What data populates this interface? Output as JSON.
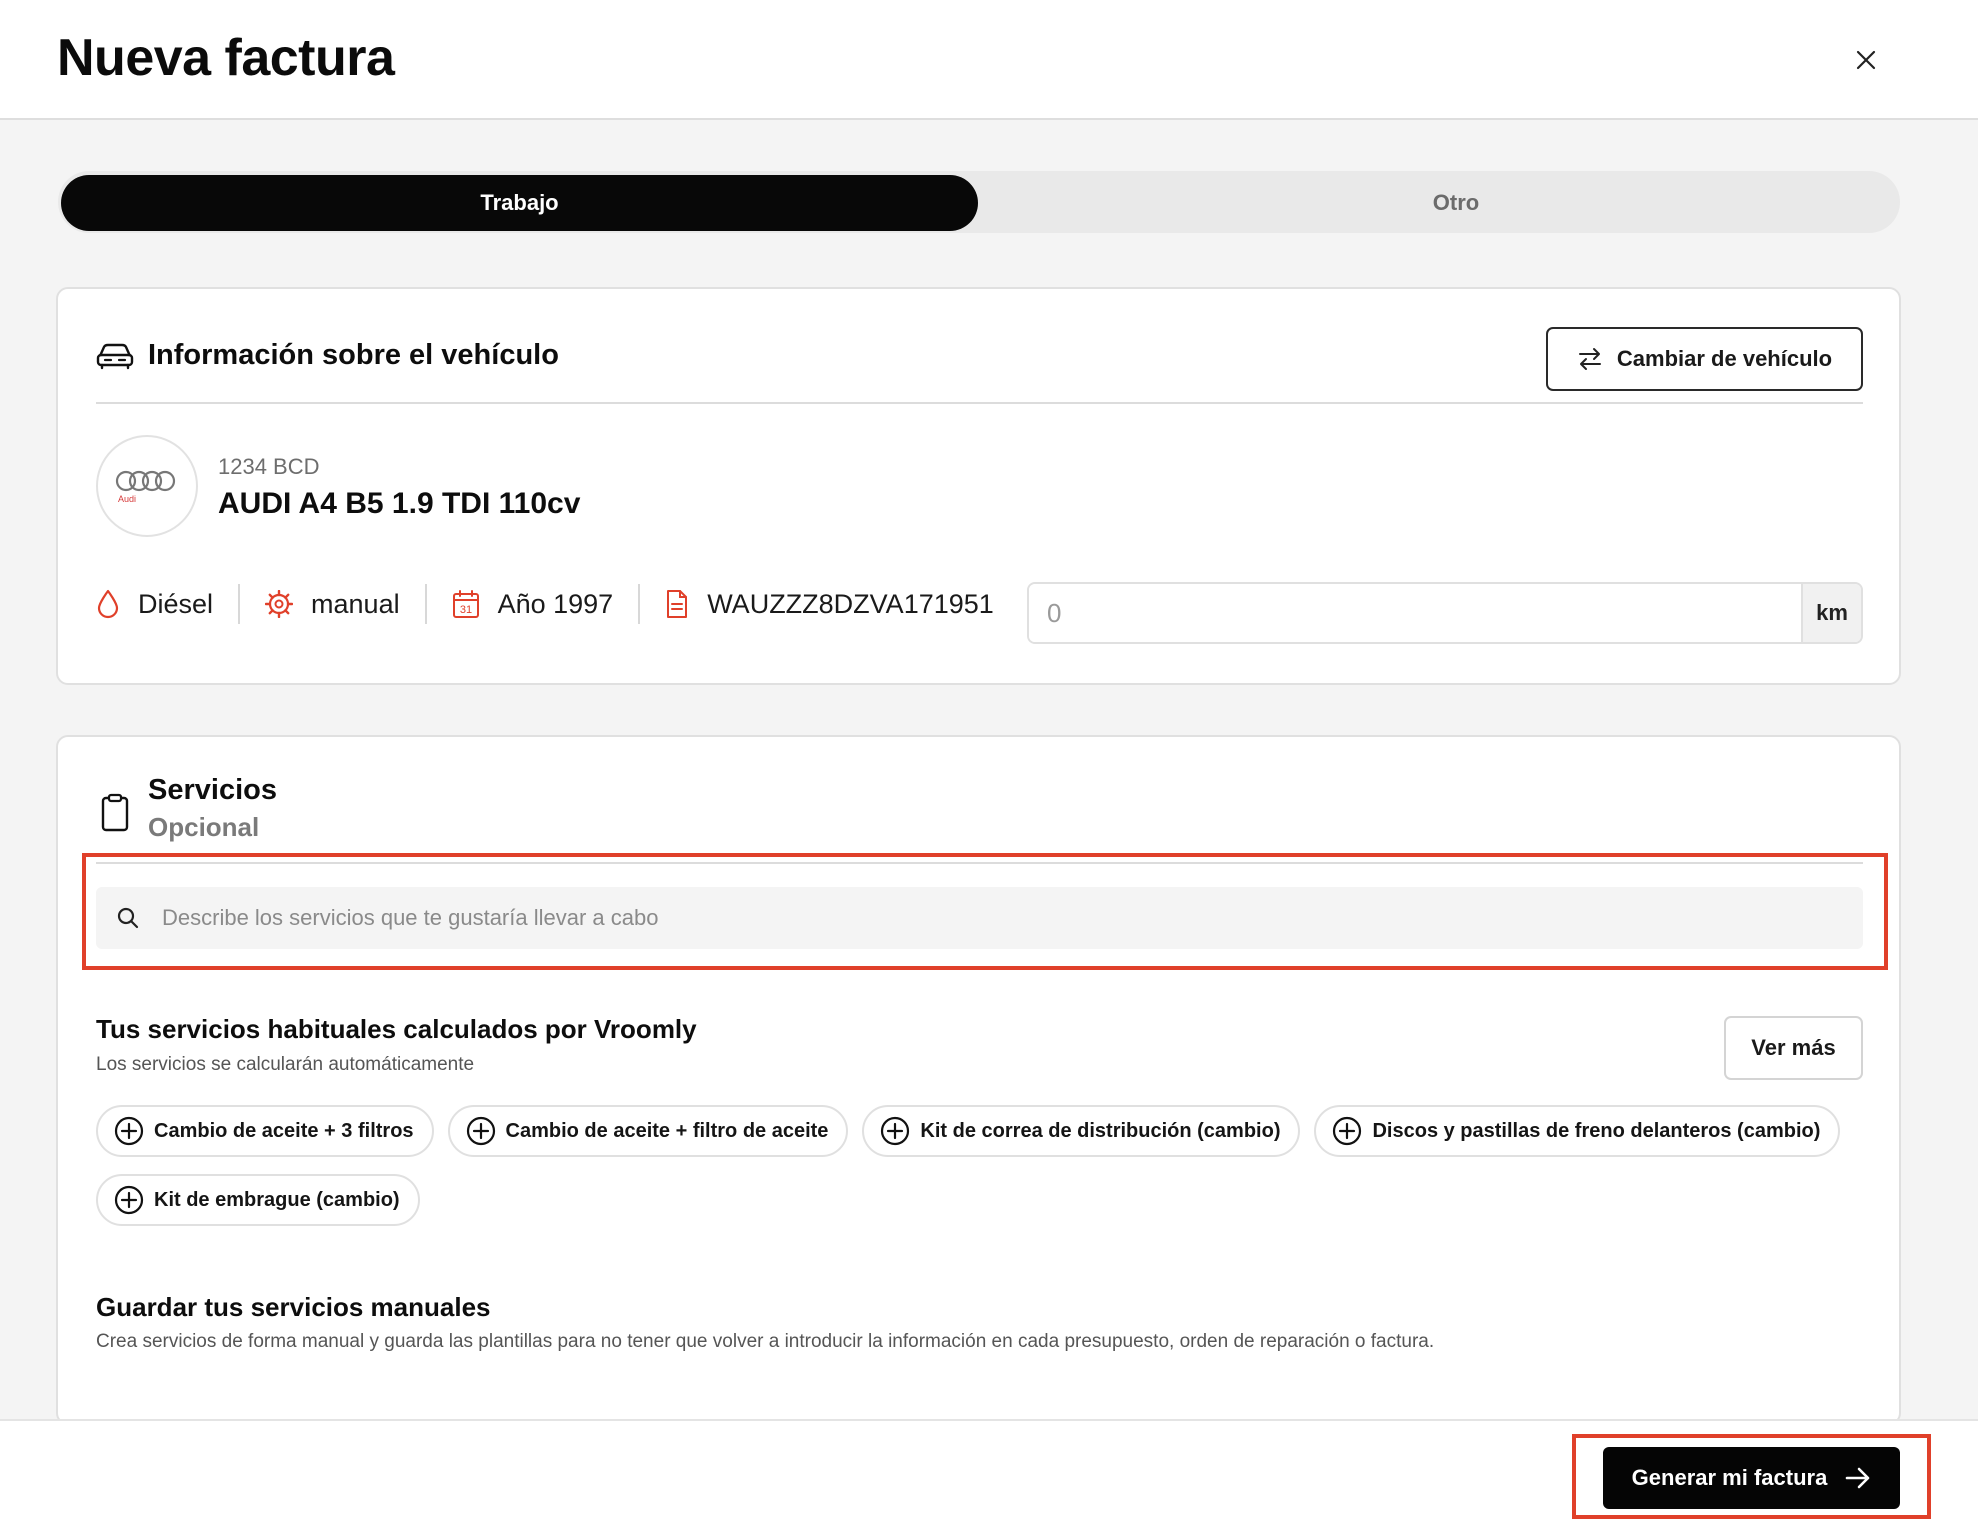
{
  "header": {
    "title": "Nueva factura"
  },
  "tabs": {
    "active": "Trabajo",
    "inactive": "Otro"
  },
  "vehicle": {
    "section_title": "Información sobre el vehículo",
    "change_button": "Cambiar de vehículo",
    "brand_logo_text": "Audi",
    "plate": "1234 BCD",
    "model": "AUDI A4 B5 1.9 TDI 110cv",
    "fuel": "Diésel",
    "transmission": "manual",
    "year": "Año 1997",
    "vin": "WAUZZZ8DZVA171951",
    "mileage_placeholder": "0",
    "mileage_unit": "km",
    "calendar_day": "31"
  },
  "services": {
    "title": "Servicios",
    "subtitle": "Opcional",
    "search_placeholder": "Describe los servicios que te gustaría llevar a cabo",
    "habitual_title": "Tus servicios habituales calculados por Vroomly",
    "habitual_subtitle": "Los servicios se calcularán automáticamente",
    "see_more": "Ver más",
    "chips": [
      "Cambio de aceite + 3 filtros",
      "Cambio de aceite + filtro de aceite",
      "Kit de correa de distribución (cambio)",
      "Discos y pastillas de freno delanteros (cambio)",
      "Kit de embrague (cambio)"
    ],
    "manual_title": "Guardar tus servicios manuales",
    "manual_subtitle": "Crea servicios de forma manual y guarda las plantillas para no tener que volver a introducir la información en cada presupuesto, orden de reparación o factura."
  },
  "footer": {
    "primary_button": "Generar mi factura"
  },
  "colors": {
    "accent": "#050505",
    "icon_red": "#e0402a",
    "highlight": "#e0402a"
  }
}
